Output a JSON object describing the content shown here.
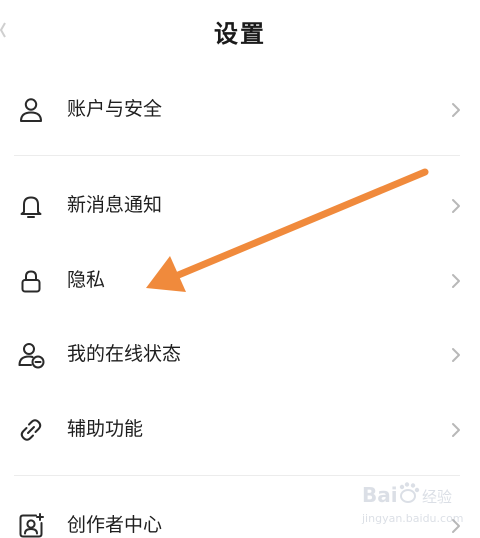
{
  "header": {
    "title": "设置"
  },
  "menu": {
    "items": [
      {
        "label": "账户与安全",
        "icon": "person-icon"
      },
      {
        "label": "新消息通知",
        "icon": "bell-icon"
      },
      {
        "label": "隐私",
        "icon": "lock-icon"
      },
      {
        "label": "我的在线状态",
        "icon": "person-status-icon"
      },
      {
        "label": "辅助功能",
        "icon": "link-icon"
      },
      {
        "label": "创作者中心",
        "icon": "creator-badge-icon"
      }
    ]
  },
  "annotation": {
    "arrow_color": "#f08a3c",
    "points_to": "隐私"
  },
  "watermark": {
    "text": "Baidu经验",
    "subtext": "jingyan.baidu.com"
  },
  "colors": {
    "text": "#1f1f1f",
    "icon": "#2a2a2a",
    "chevron": "#b8b8b8",
    "divider": "#ececec"
  }
}
